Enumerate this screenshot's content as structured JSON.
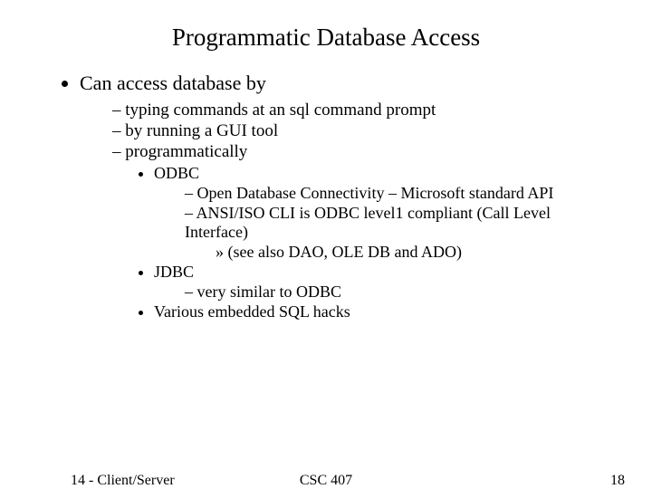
{
  "title": "Programmatic Database Access",
  "bullet1": "Can access database by",
  "sub": {
    "a": "typing commands at an sql command prompt",
    "b": "by running a GUI tool",
    "c": "programmatically"
  },
  "prog": {
    "odbc": "ODBC",
    "odbc_sub1": "Open Database Connectivity – Microsoft standard API",
    "odbc_sub2": "ANSI/ISO CLI is ODBC level1 compliant (Call Level Interface)",
    "odbc_sub2_see": "(see also DAO, OLE DB and ADO)",
    "jdbc": "JDBC",
    "jdbc_sub1": "very similar to ODBC",
    "various": "Various embedded SQL hacks"
  },
  "footer": {
    "left": "14 - Client/Server",
    "center": "CSC 407",
    "right": "18"
  }
}
